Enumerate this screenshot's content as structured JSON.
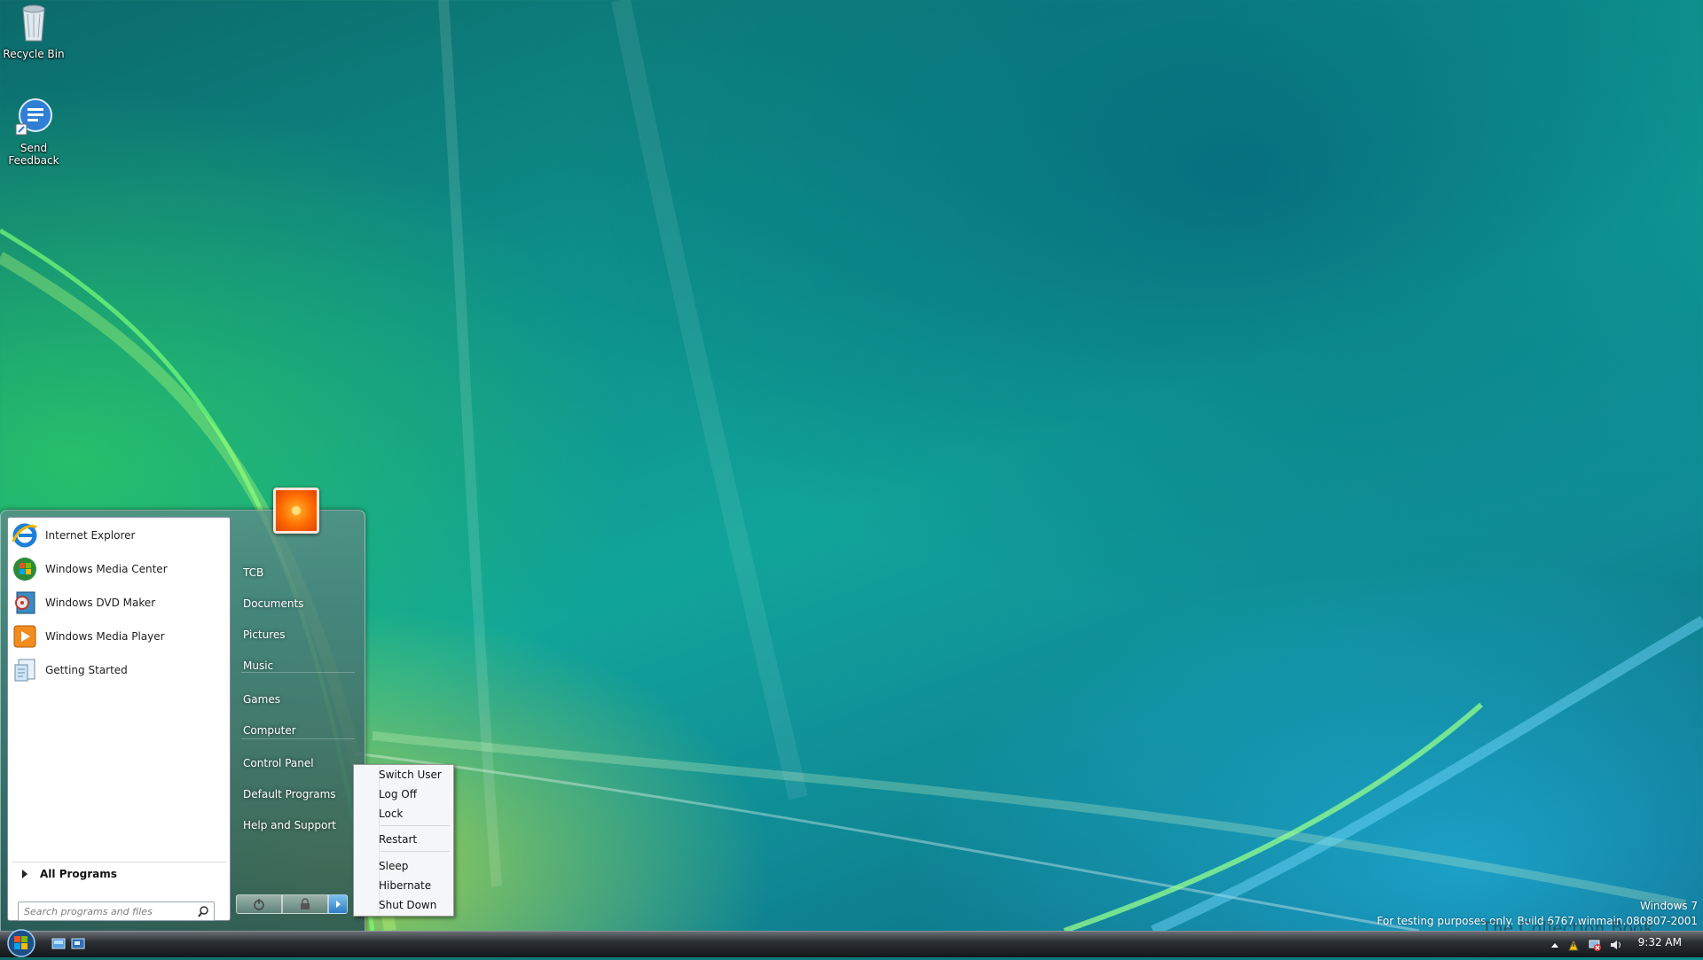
{
  "desktop": {
    "icons": [
      {
        "label": "Recycle Bin",
        "icon": "recycle-bin-icon"
      },
      {
        "label": "Send Feedback",
        "icon": "send-feedback-icon"
      }
    ],
    "watermark": {
      "line1": "Windows 7",
      "line2": "For testing purposes only. Build 6767.winmain.080807-2001"
    },
    "overlay_text": "The Collection Book"
  },
  "start_menu": {
    "pinned_programs": [
      {
        "label": "Internet Explorer",
        "icon": "internet-explorer-icon"
      },
      {
        "label": "Windows Media Center",
        "icon": "windows-media-center-icon"
      },
      {
        "label": "Windows DVD Maker",
        "icon": "windows-dvd-maker-icon"
      },
      {
        "label": "Windows Media Player",
        "icon": "windows-media-player-icon"
      },
      {
        "label": "Getting Started",
        "icon": "getting-started-icon"
      }
    ],
    "all_programs": "All Programs",
    "search_placeholder": "Search programs and files",
    "right_items": [
      "TCB",
      "Documents",
      "Pictures",
      "Music",
      "Games",
      "Computer",
      "Control Panel",
      "Default Programs",
      "Help and Support"
    ],
    "power_buttons": [
      "power-icon",
      "lock-icon",
      "arrow-right-icon"
    ]
  },
  "power_submenu": {
    "items": [
      "Switch User",
      "Log Off",
      "Lock",
      "Restart",
      "Sleep",
      "Hibernate",
      "Shut Down"
    ]
  },
  "taskbar": {
    "clock": "9:32 AM",
    "quick_launch": [
      "show-desktop-icon",
      "switch-windows-icon"
    ],
    "tray_icons": [
      "show-hidden-icons-icon",
      "action-center-icon",
      "network-icon",
      "volume-icon"
    ]
  }
}
